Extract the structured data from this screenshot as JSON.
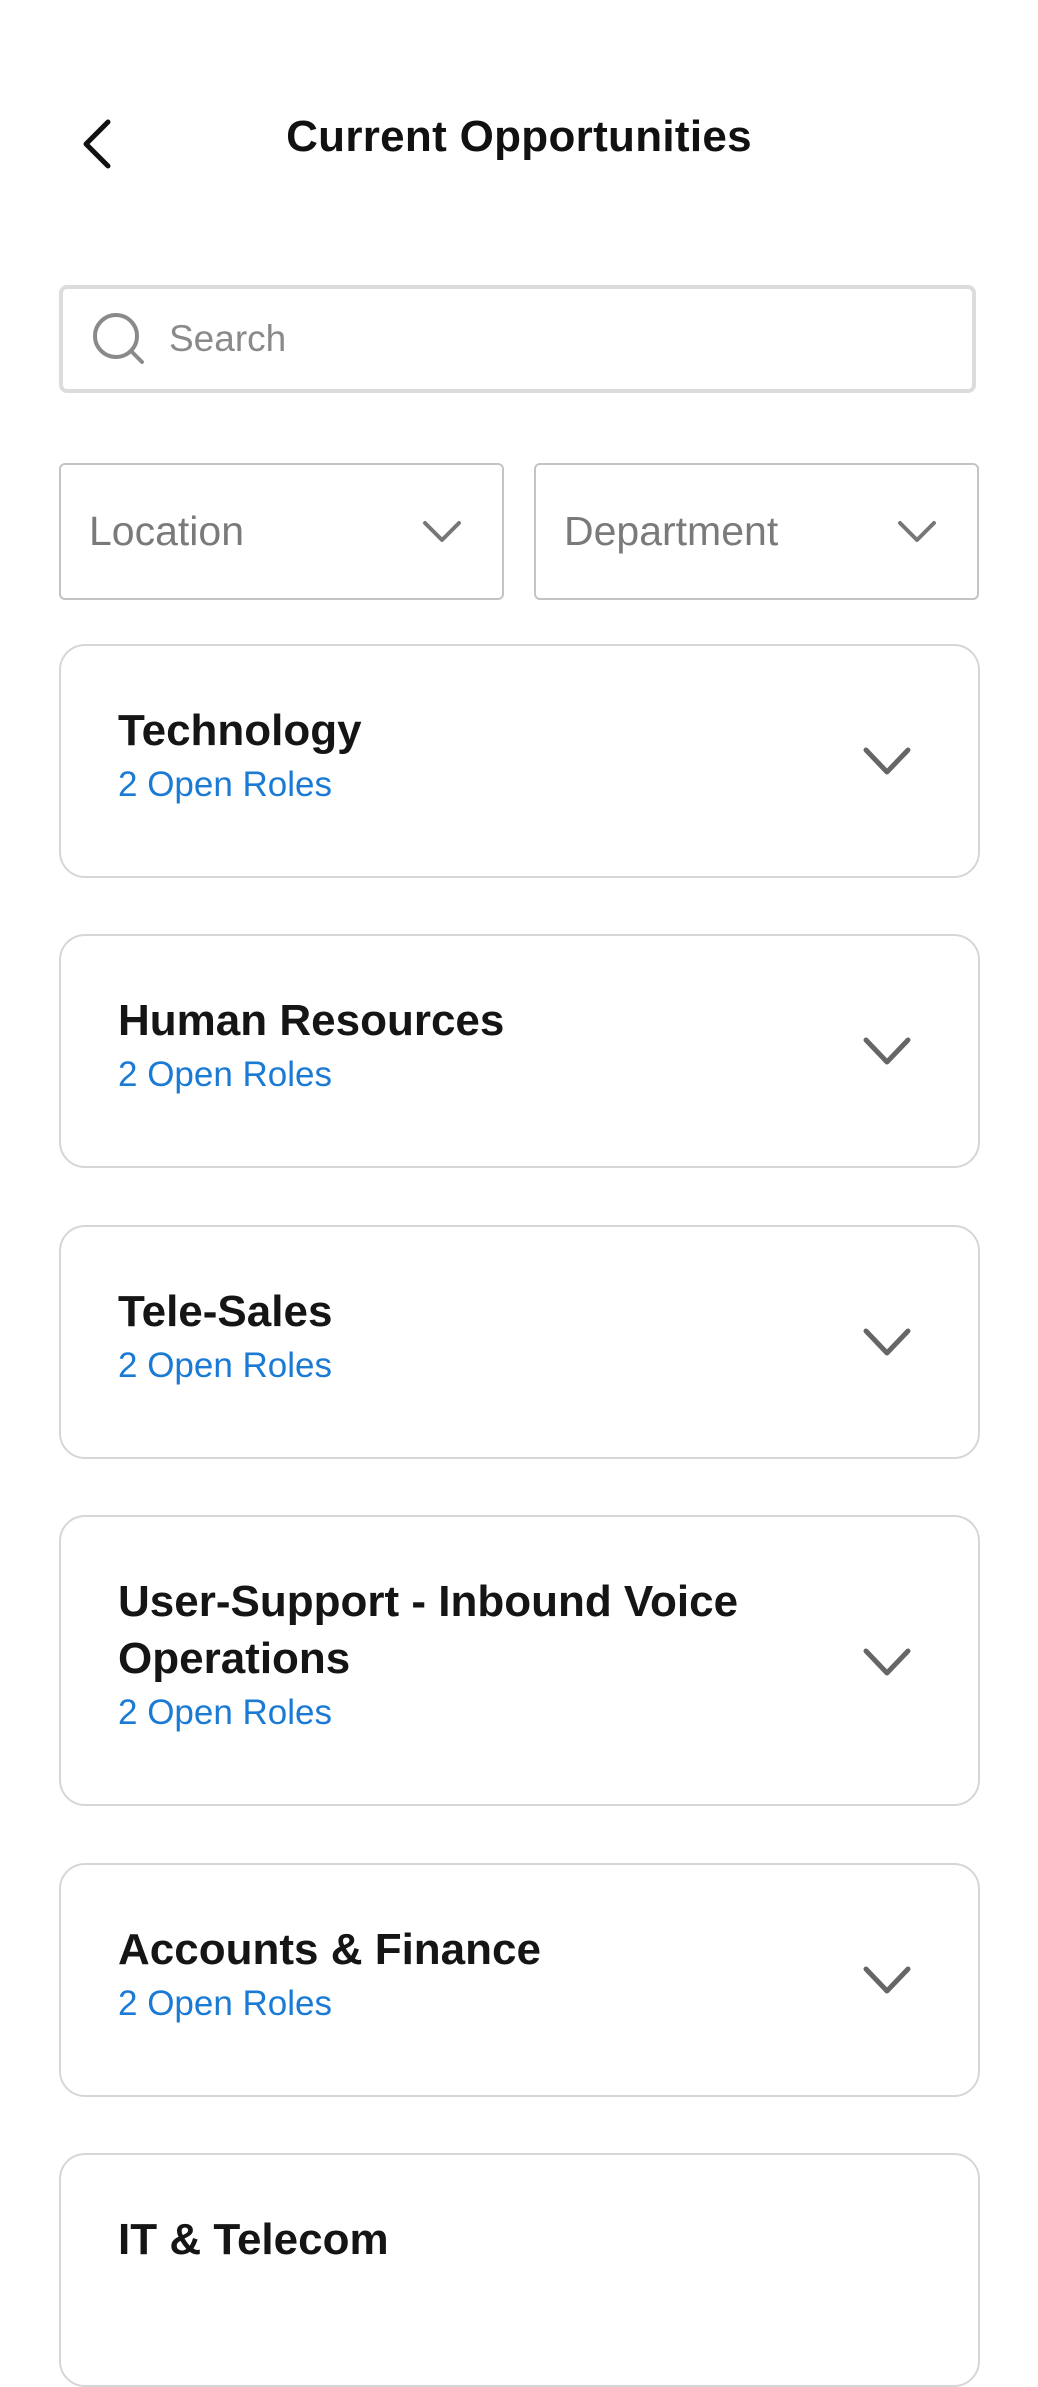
{
  "header": {
    "title": "Current Opportunities",
    "back_icon": "chevron-left-icon"
  },
  "search": {
    "placeholder": "Search",
    "value": "",
    "icon": "search-icon"
  },
  "filters": {
    "location_label": "Location",
    "department_label": "Department",
    "icon": "chevron-down-icon"
  },
  "departments": [
    {
      "name": "Technology",
      "roles": "2 Open Roles"
    },
    {
      "name": "Human Resources",
      "roles": "2 Open Roles"
    },
    {
      "name": "Tele-Sales",
      "roles": "2 Open Roles"
    },
    {
      "name": "User-Support - Inbound Voice Operations",
      "roles": "2 Open Roles"
    },
    {
      "name": "Accounts & Finance",
      "roles": "2 Open Roles"
    },
    {
      "name": "IT & Telecom",
      "roles": ""
    }
  ],
  "colors": {
    "accent": "#1a7ad4",
    "border": "#d6d6d6",
    "text": "#151515",
    "muted": "#7a7a7a"
  }
}
